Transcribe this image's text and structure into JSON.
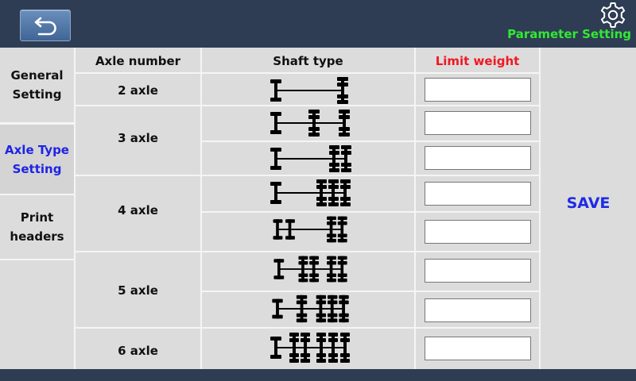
{
  "header": {
    "title": "Parameter Setting"
  },
  "icons": {
    "back": "back-arrow-icon",
    "settings": "gear-icon"
  },
  "colors": {
    "title": "#33e833",
    "active_tab": "#1e23e6",
    "limit_header": "#f01822",
    "save": "#1e2be6",
    "bar": "#2e3d54"
  },
  "sidebar": {
    "items": [
      {
        "line1": "General",
        "line2": "Setting",
        "active": false
      },
      {
        "line1": "Axle Type",
        "line2": "Setting",
        "active": true
      },
      {
        "line1": "Print",
        "line2": "headers",
        "active": false
      }
    ]
  },
  "table": {
    "headers": {
      "axle_number": "Axle number",
      "shaft_type": "Shaft type",
      "limit_weight": "Limit weight"
    },
    "groups": [
      "2 axle",
      "3 axle",
      "4 axle",
      "5 axle",
      "6 axle"
    ],
    "rows": [
      {
        "axle": "2 axle",
        "shaft_icon": "shaft-2-axle-icon",
        "limit_weight": ""
      },
      {
        "axle": "3 axle",
        "shaft_icon": "shaft-3-axle-a-icon",
        "limit_weight": ""
      },
      {
        "axle": "3 axle",
        "shaft_icon": "shaft-3-axle-b-icon",
        "limit_weight": ""
      },
      {
        "axle": "4 axle",
        "shaft_icon": "shaft-4-axle-a-icon",
        "limit_weight": ""
      },
      {
        "axle": "4 axle",
        "shaft_icon": "shaft-4-axle-b-icon",
        "limit_weight": ""
      },
      {
        "axle": "5 axle",
        "shaft_icon": "shaft-5-axle-a-icon",
        "limit_weight": ""
      },
      {
        "axle": "5 axle",
        "shaft_icon": "shaft-5-axle-b-icon",
        "limit_weight": ""
      },
      {
        "axle": "6 axle",
        "shaft_icon": "shaft-6-axle-icon",
        "limit_weight": ""
      }
    ]
  },
  "save_label": "SAVE"
}
